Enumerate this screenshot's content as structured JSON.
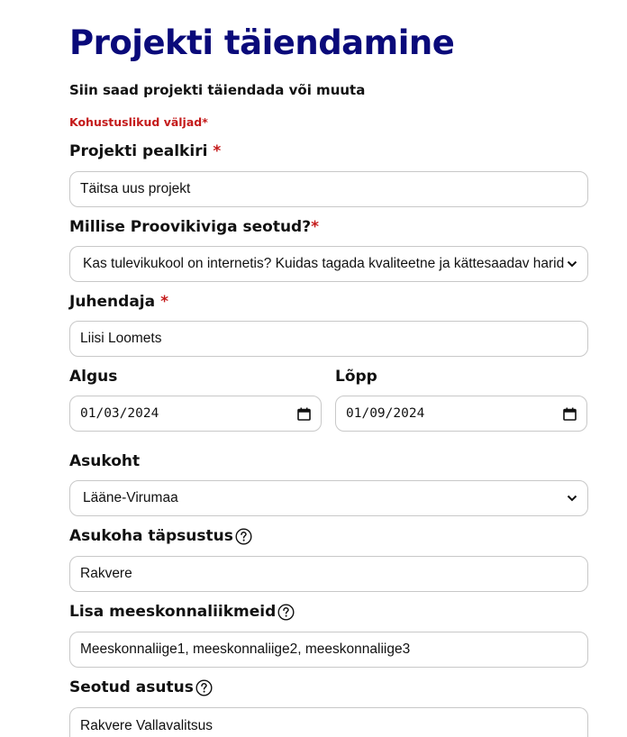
{
  "page": {
    "title": "Projekti täiendamine",
    "subtitle": "Siin saad projekti täiendada või muuta",
    "required_note": "Kohustuslikud väljad*"
  },
  "form": {
    "title": {
      "label": "Projekti pealkiri",
      "required_mark": "*",
      "value": "Täitsa uus projekt"
    },
    "proovikivi": {
      "label": "Millise Proovikiviga seotud?",
      "required_mark": "*",
      "value": "Kas tulevikukool on internetis? Kuidas tagada kvaliteetne ja kättesaadav haridus"
    },
    "supervisor": {
      "label": "Juhendaja",
      "required_mark": "*",
      "value": "Liisi Loomets"
    },
    "start": {
      "label": "Algus",
      "value": "01/03/2024"
    },
    "end": {
      "label": "Lõpp",
      "value": "01/09/2024"
    },
    "location": {
      "label": "Asukoht",
      "value": "Lääne-Virumaa"
    },
    "location_detail": {
      "label": "Asukoha täpsustus",
      "value": "Rakvere"
    },
    "team_members": {
      "label": "Lisa meeskonnaliikmeid",
      "value": "Meeskonnaliige1, meeskonnaliige2, meeskonnaliige3"
    },
    "institution": {
      "label": "Seotud asutus",
      "value": "Rakvere Vallavalitsus"
    }
  },
  "icons": {
    "help": "question-circle-icon",
    "dropdown": "chevron-down-icon",
    "calendar": "calendar-icon"
  },
  "colors": {
    "title": "#0a0a7a",
    "required": "#c41a1a",
    "field_border": "#c8c8c8"
  }
}
